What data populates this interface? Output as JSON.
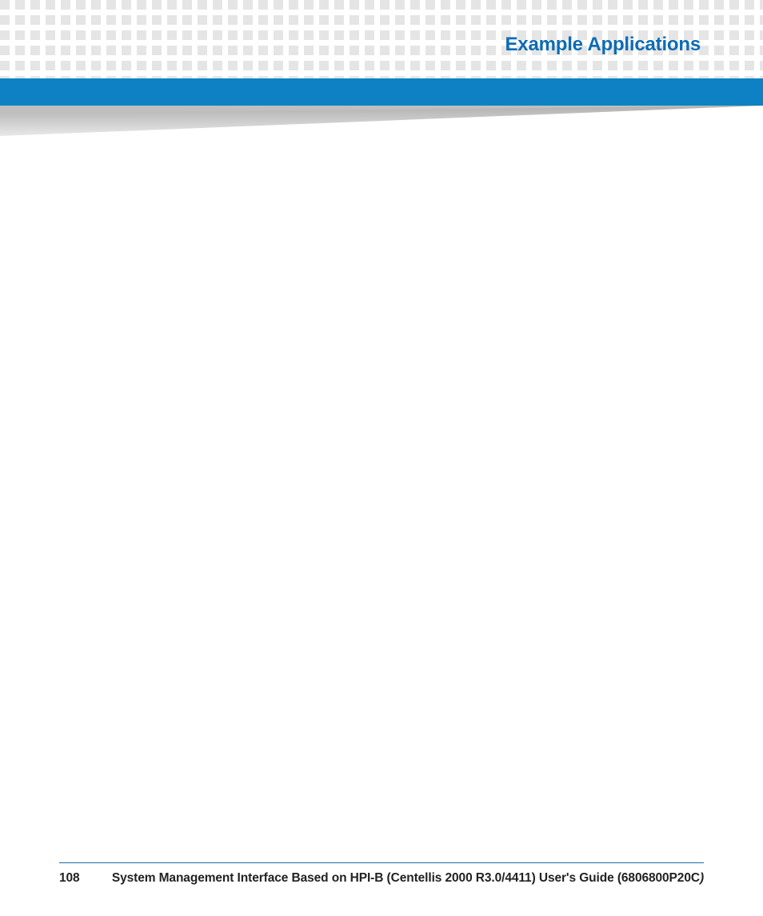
{
  "header": {
    "title": "Example Applications"
  },
  "footer": {
    "page_number": "108",
    "doc_title_main": "System Management Interface Based on HPI-B (Centellis 2000 R3.0/4411) User's Guide (6806800P20C",
    "doc_title_trailing_paren": ")"
  },
  "colors": {
    "accent_blue": "#0d81c4",
    "title_blue": "#0d6bb5",
    "grid_gray": "#e5e5e5",
    "wedge_gray_light": "#d9d9d9",
    "wedge_gray_dark": "#b0b0b0",
    "rule_blue": "#1f6aa6"
  }
}
